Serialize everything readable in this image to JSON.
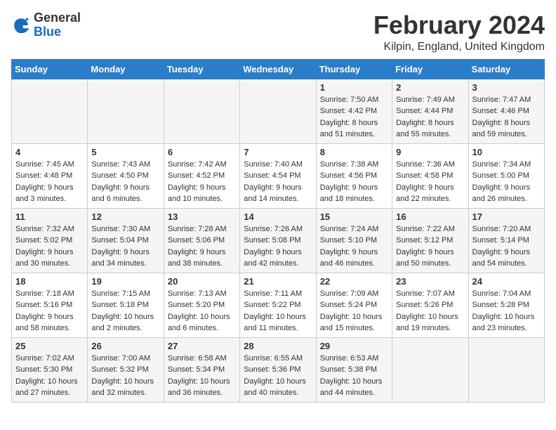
{
  "logo": {
    "general": "General",
    "blue": "Blue"
  },
  "header": {
    "title": "February 2024",
    "subtitle": "Kilpin, England, United Kingdom"
  },
  "weekdays": [
    "Sunday",
    "Monday",
    "Tuesday",
    "Wednesday",
    "Thursday",
    "Friday",
    "Saturday"
  ],
  "weeks": [
    [
      {
        "day": "",
        "info": ""
      },
      {
        "day": "",
        "info": ""
      },
      {
        "day": "",
        "info": ""
      },
      {
        "day": "",
        "info": ""
      },
      {
        "day": "1",
        "info": "Sunrise: 7:50 AM\nSunset: 4:42 PM\nDaylight: 8 hours\nand 51 minutes."
      },
      {
        "day": "2",
        "info": "Sunrise: 7:49 AM\nSunset: 4:44 PM\nDaylight: 8 hours\nand 55 minutes."
      },
      {
        "day": "3",
        "info": "Sunrise: 7:47 AM\nSunset: 4:46 PM\nDaylight: 8 hours\nand 59 minutes."
      }
    ],
    [
      {
        "day": "4",
        "info": "Sunrise: 7:45 AM\nSunset: 4:48 PM\nDaylight: 9 hours\nand 3 minutes."
      },
      {
        "day": "5",
        "info": "Sunrise: 7:43 AM\nSunset: 4:50 PM\nDaylight: 9 hours\nand 6 minutes."
      },
      {
        "day": "6",
        "info": "Sunrise: 7:42 AM\nSunset: 4:52 PM\nDaylight: 9 hours\nand 10 minutes."
      },
      {
        "day": "7",
        "info": "Sunrise: 7:40 AM\nSunset: 4:54 PM\nDaylight: 9 hours\nand 14 minutes."
      },
      {
        "day": "8",
        "info": "Sunrise: 7:38 AM\nSunset: 4:56 PM\nDaylight: 9 hours\nand 18 minutes."
      },
      {
        "day": "9",
        "info": "Sunrise: 7:36 AM\nSunset: 4:58 PM\nDaylight: 9 hours\nand 22 minutes."
      },
      {
        "day": "10",
        "info": "Sunrise: 7:34 AM\nSunset: 5:00 PM\nDaylight: 9 hours\nand 26 minutes."
      }
    ],
    [
      {
        "day": "11",
        "info": "Sunrise: 7:32 AM\nSunset: 5:02 PM\nDaylight: 9 hours\nand 30 minutes."
      },
      {
        "day": "12",
        "info": "Sunrise: 7:30 AM\nSunset: 5:04 PM\nDaylight: 9 hours\nand 34 minutes."
      },
      {
        "day": "13",
        "info": "Sunrise: 7:28 AM\nSunset: 5:06 PM\nDaylight: 9 hours\nand 38 minutes."
      },
      {
        "day": "14",
        "info": "Sunrise: 7:26 AM\nSunset: 5:08 PM\nDaylight: 9 hours\nand 42 minutes."
      },
      {
        "day": "15",
        "info": "Sunrise: 7:24 AM\nSunset: 5:10 PM\nDaylight: 9 hours\nand 46 minutes."
      },
      {
        "day": "16",
        "info": "Sunrise: 7:22 AM\nSunset: 5:12 PM\nDaylight: 9 hours\nand 50 minutes."
      },
      {
        "day": "17",
        "info": "Sunrise: 7:20 AM\nSunset: 5:14 PM\nDaylight: 9 hours\nand 54 minutes."
      }
    ],
    [
      {
        "day": "18",
        "info": "Sunrise: 7:18 AM\nSunset: 5:16 PM\nDaylight: 9 hours\nand 58 minutes."
      },
      {
        "day": "19",
        "info": "Sunrise: 7:15 AM\nSunset: 5:18 PM\nDaylight: 10 hours\nand 2 minutes."
      },
      {
        "day": "20",
        "info": "Sunrise: 7:13 AM\nSunset: 5:20 PM\nDaylight: 10 hours\nand 6 minutes."
      },
      {
        "day": "21",
        "info": "Sunrise: 7:11 AM\nSunset: 5:22 PM\nDaylight: 10 hours\nand 11 minutes."
      },
      {
        "day": "22",
        "info": "Sunrise: 7:09 AM\nSunset: 5:24 PM\nDaylight: 10 hours\nand 15 minutes."
      },
      {
        "day": "23",
        "info": "Sunrise: 7:07 AM\nSunset: 5:26 PM\nDaylight: 10 hours\nand 19 minutes."
      },
      {
        "day": "24",
        "info": "Sunrise: 7:04 AM\nSunset: 5:28 PM\nDaylight: 10 hours\nand 23 minutes."
      }
    ],
    [
      {
        "day": "25",
        "info": "Sunrise: 7:02 AM\nSunset: 5:30 PM\nDaylight: 10 hours\nand 27 minutes."
      },
      {
        "day": "26",
        "info": "Sunrise: 7:00 AM\nSunset: 5:32 PM\nDaylight: 10 hours\nand 32 minutes."
      },
      {
        "day": "27",
        "info": "Sunrise: 6:58 AM\nSunset: 5:34 PM\nDaylight: 10 hours\nand 36 minutes."
      },
      {
        "day": "28",
        "info": "Sunrise: 6:55 AM\nSunset: 5:36 PM\nDaylight: 10 hours\nand 40 minutes."
      },
      {
        "day": "29",
        "info": "Sunrise: 6:53 AM\nSunset: 5:38 PM\nDaylight: 10 hours\nand 44 minutes."
      },
      {
        "day": "",
        "info": ""
      },
      {
        "day": "",
        "info": ""
      }
    ]
  ]
}
